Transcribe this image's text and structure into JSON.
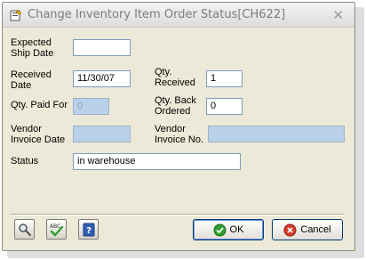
{
  "window": {
    "title": "Change Inventory Item Order Status[CH622]",
    "close_glyph": "✕",
    "app_icon": "form-icon"
  },
  "form": {
    "expected_ship_date": {
      "label_line1": "Expected",
      "label_line2": "Ship Date",
      "value": ""
    },
    "received_date": {
      "label_line1": "Received",
      "label_line2": "Date",
      "value": "11/30/07"
    },
    "qty_received": {
      "label_line1": "Qty.",
      "label_line2": "Received",
      "value": "1"
    },
    "qty_paid_for": {
      "label": "Qty. Paid For",
      "value": "0"
    },
    "qty_back_ordered": {
      "label_line1": "Qty. Back",
      "label_line2": "Ordered",
      "value": "0"
    },
    "vendor_invoice_date": {
      "label_line1": "Vendor",
      "label_line2": "Invoice Date",
      "value": ""
    },
    "vendor_invoice_no": {
      "label_line1": "Vendor",
      "label_line2": "Invoice No.",
      "value": ""
    },
    "status": {
      "label": "Status",
      "value": "in warehouse"
    }
  },
  "toolbar": {
    "search_icon": "magnifier-icon",
    "spellcheck_icon": "spellcheck-icon",
    "help_icon": "help-icon",
    "ok_label": "OK",
    "cancel_label": "Cancel"
  },
  "colors": {
    "window_bg": "#ece9d8",
    "disabled_field": "#b9d1ea",
    "ok_green": "#2e9e2e",
    "cancel_red": "#d83a2a"
  }
}
